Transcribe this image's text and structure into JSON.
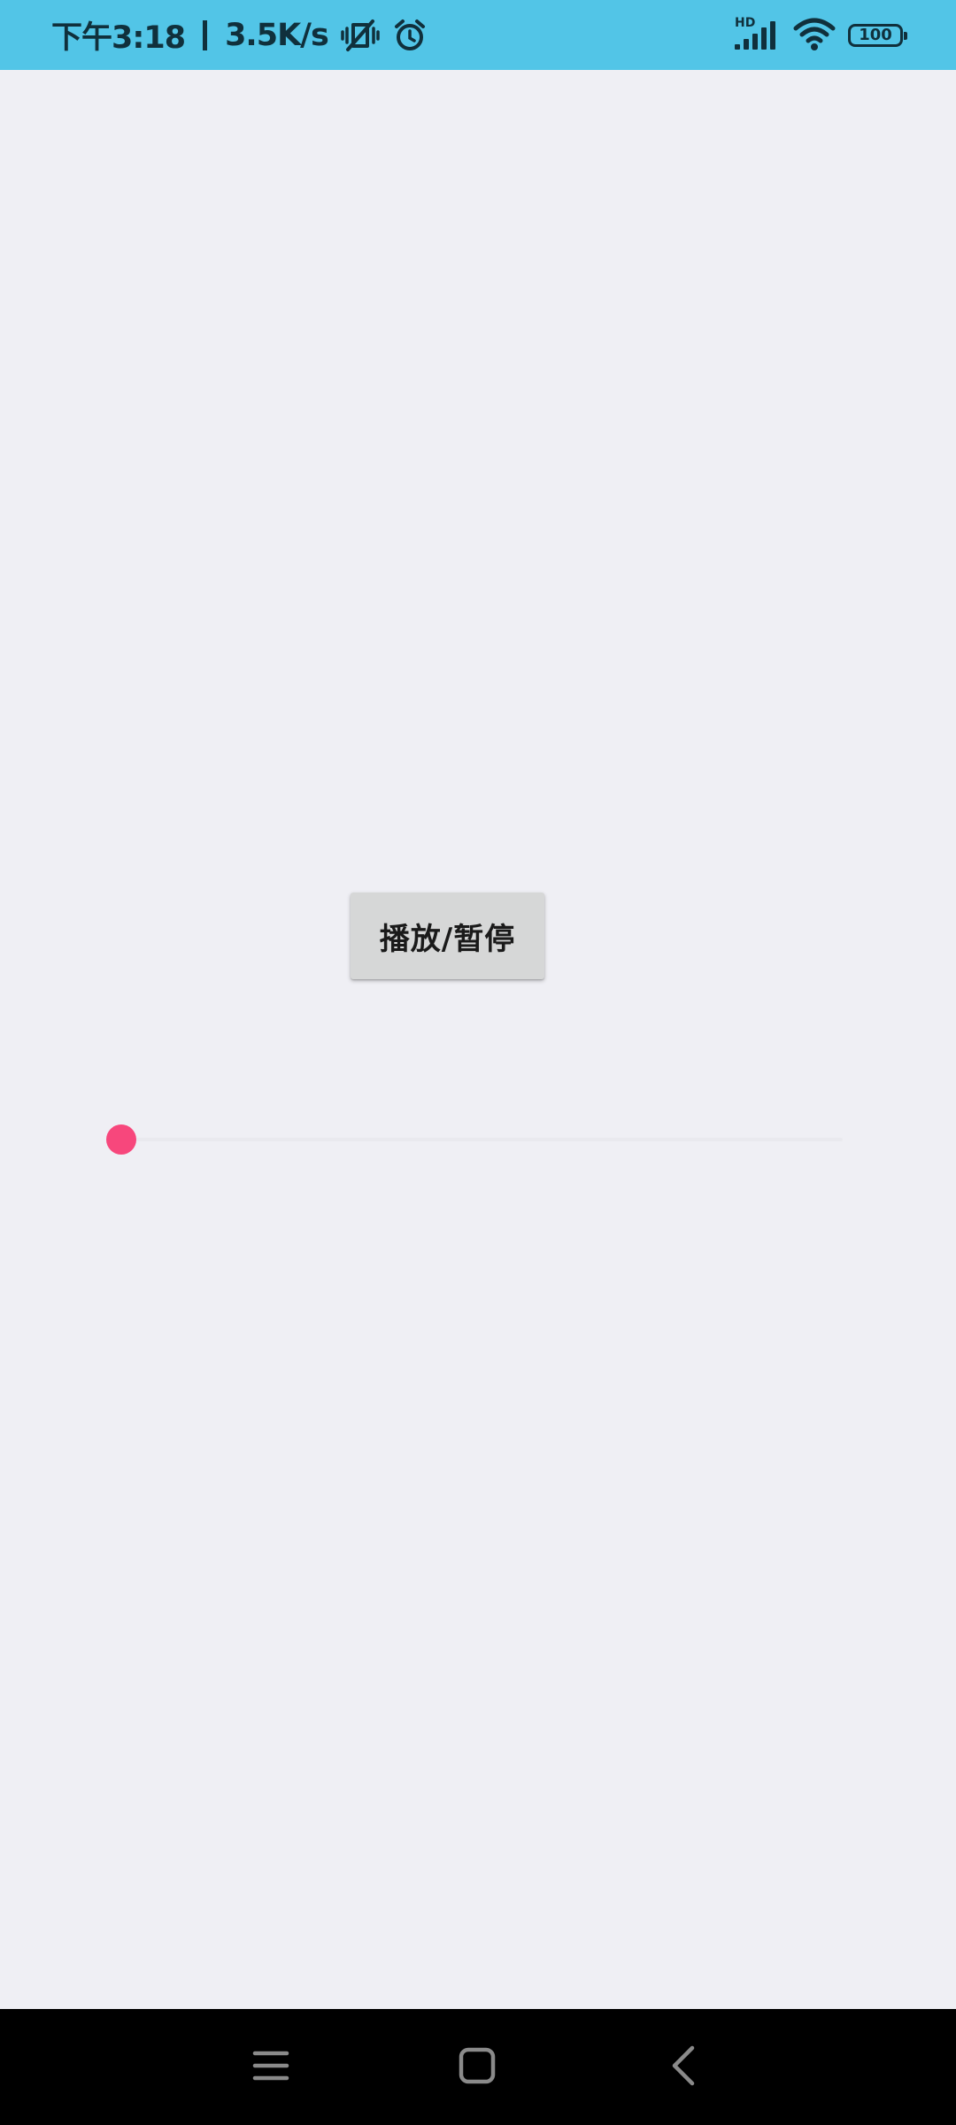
{
  "status_bar": {
    "time": "下午3:18",
    "network_speed": "3.5K/s",
    "network_type_label": "HD",
    "battery_level": "100",
    "icons": [
      "vibrate-off-icon",
      "alarm-icon",
      "signal-icon",
      "wifi-icon",
      "battery-icon"
    ]
  },
  "main": {
    "play_pause_label": "播放/暂停",
    "seekbar": {
      "progress": 0,
      "accent_color": "#f7477c"
    }
  },
  "nav_bar": {
    "buttons": [
      "menu-icon",
      "home-icon",
      "back-icon"
    ]
  },
  "colors": {
    "status_bar_bg": "#52c5e7",
    "page_bg": "#efeff4",
    "button_bg": "#d6d7d7",
    "nav_bar_bg": "#000000"
  }
}
